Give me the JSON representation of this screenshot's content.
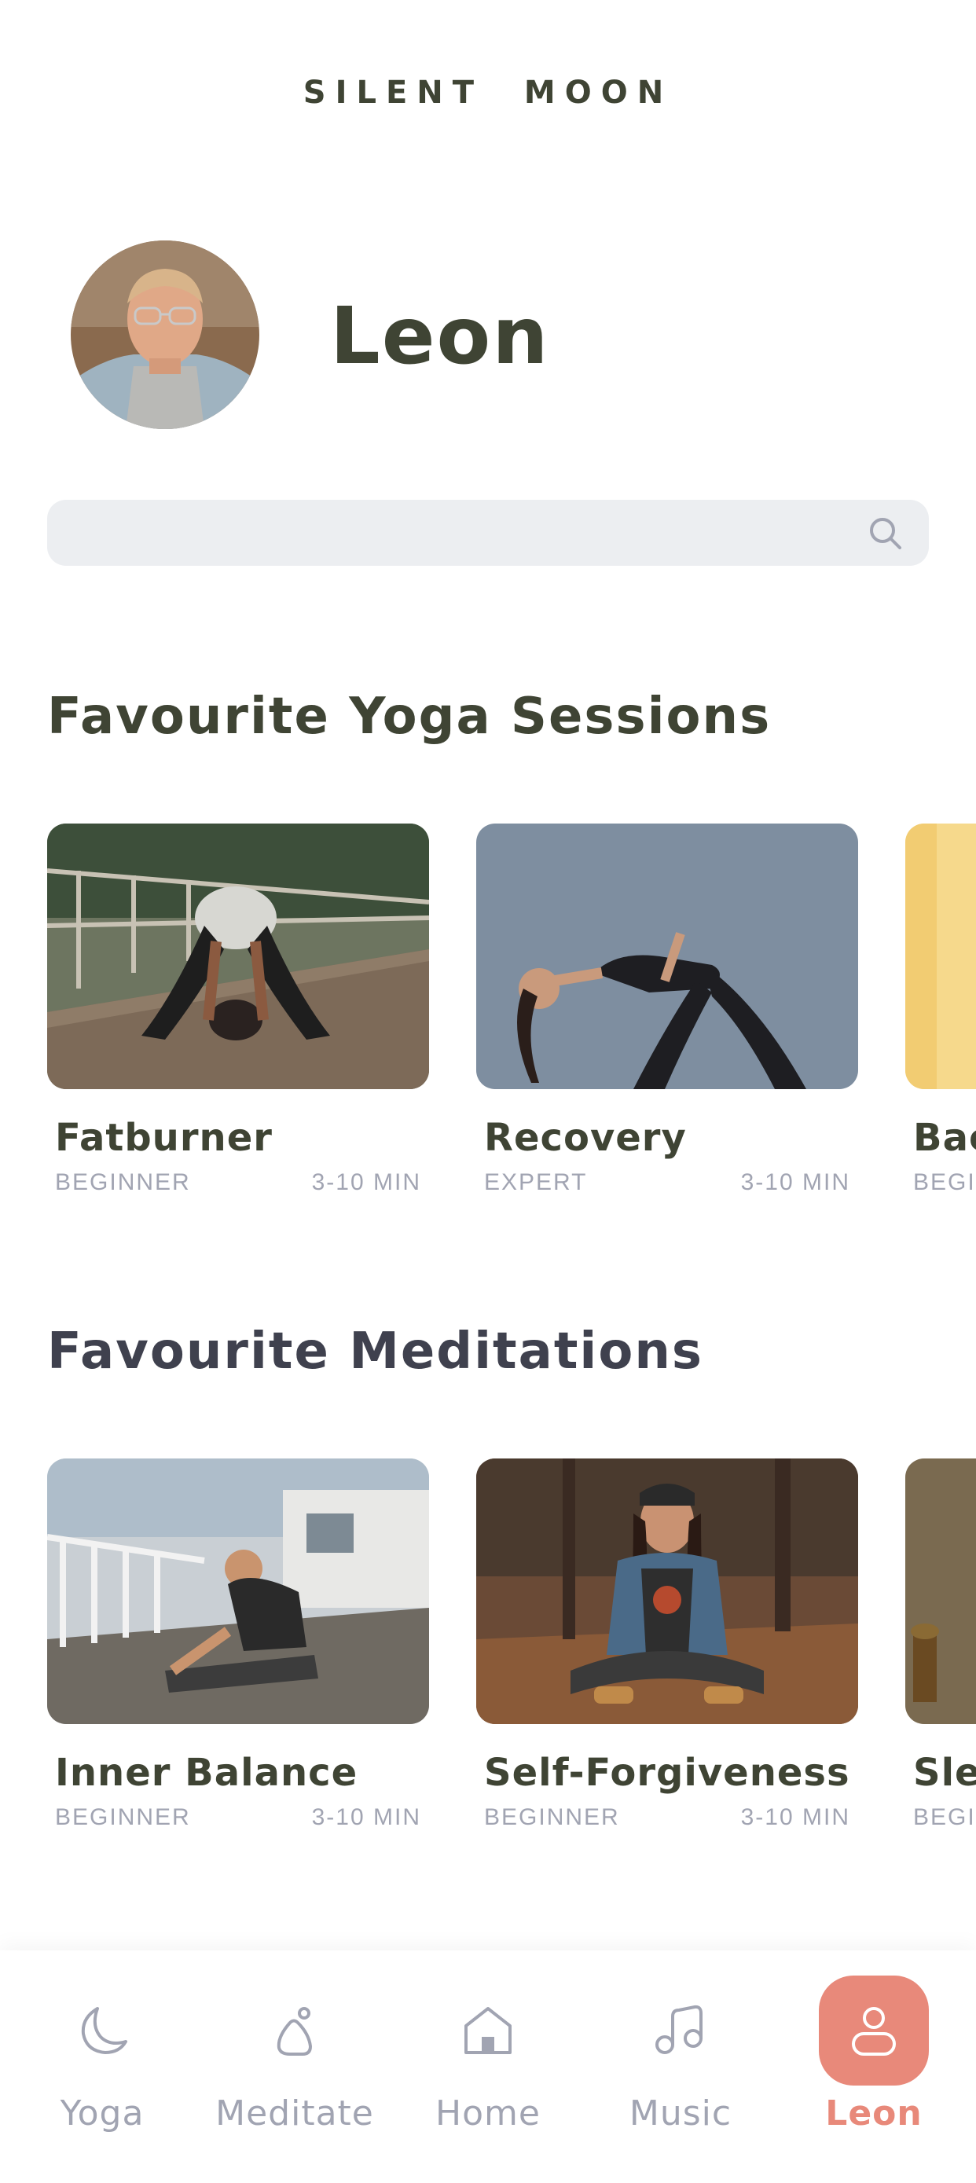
{
  "app": {
    "brand": "SILENT  MOON"
  },
  "profile": {
    "name": "Leon"
  },
  "search": {
    "placeholder": "",
    "value": ""
  },
  "sections": {
    "yoga": {
      "title": "Favourite Yoga Sessions",
      "color": "#3f4434",
      "cards": [
        {
          "title": "Fatburner",
          "level": "BEGINNER",
          "duration": "3-10 MIN"
        },
        {
          "title": "Recovery",
          "level": "EXPERT",
          "duration": "3-10 MIN"
        },
        {
          "title": "Bac",
          "level": "BEGI",
          "duration": ""
        }
      ]
    },
    "meditations": {
      "title": "Favourite Meditations",
      "color": "#3f414e",
      "cards": [
        {
          "title": "Inner Balance",
          "level": "BEGINNER",
          "duration": "3-10 MIN"
        },
        {
          "title": "Self-Forgiveness",
          "level": "BEGINNER",
          "duration": "3-10 MIN"
        },
        {
          "title": "Sle",
          "level": "BEGI",
          "duration": ""
        }
      ]
    }
  },
  "nav": {
    "items": [
      {
        "label": "Yoga",
        "icon": "moon-icon",
        "active": false
      },
      {
        "label": "Meditate",
        "icon": "meditate-icon",
        "active": false
      },
      {
        "label": "Home",
        "icon": "home-icon",
        "active": false
      },
      {
        "label": "Music",
        "icon": "music-icon",
        "active": false
      },
      {
        "label": "Leon",
        "icon": "user-icon",
        "active": true
      }
    ]
  },
  "colors": {
    "primary_text": "#3f4434",
    "secondary_text": "#a1a4b2",
    "accent": "#e8897a",
    "search_bg": "#eceef1"
  }
}
